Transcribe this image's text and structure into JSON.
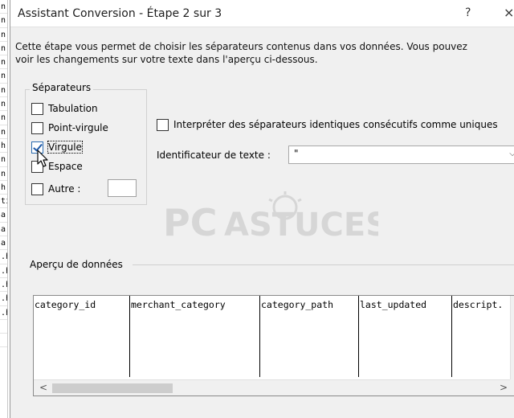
{
  "background_sheet": {
    "cells": [
      "n",
      "n",
      "n",
      "n",
      "n",
      "n",
      "n",
      "n",
      "n",
      "n",
      "h",
      "n",
      "n",
      "h",
      "tı",
      "a",
      "a",
      "a",
      ".h",
      ".h",
      ".h",
      ".h",
      ".h",
      "",
      ""
    ]
  },
  "dialog": {
    "title": "Assistant Conversion - Étape 2 sur 3",
    "help": "?",
    "close": "×",
    "intro_line1": "Cette étape vous permet de choisir les séparateurs contenus dans vos données. Vous pouvez",
    "intro_line2": "voir les changements sur votre texte dans l'aperçu ci-dessous."
  },
  "separators": {
    "legend": "Séparateurs",
    "items": [
      {
        "label": "Tabulation",
        "checked": false
      },
      {
        "label": "Point-virgule",
        "checked": false
      },
      {
        "label": "Virgule",
        "checked": true
      },
      {
        "label": "Espace",
        "checked": false
      },
      {
        "label": "Autre :",
        "checked": false
      }
    ],
    "other_value": ""
  },
  "consecutive": {
    "label": "Interpréter des séparateurs identiques consécutifs comme uniques",
    "checked": false
  },
  "text_qualifier": {
    "label": "Identificateur de texte :",
    "value": "\""
  },
  "watermark": {
    "text_left": "PC",
    "text_right": "ASTUCES"
  },
  "preview": {
    "legend": "Aperçu de données",
    "columns": [
      "category_id",
      "merchant_category",
      "category_path",
      "last_updated",
      "descript."
    ],
    "scroll_left": "<",
    "scroll_right": ">",
    "scroll_up": "▲",
    "scroll_down": "▼"
  }
}
